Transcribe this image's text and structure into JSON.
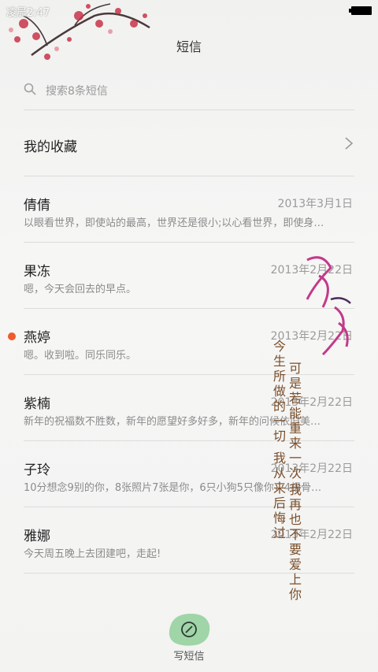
{
  "status": {
    "time": "凌晨2:47"
  },
  "header": {
    "title": "短信"
  },
  "search": {
    "placeholder": "搜索8条短信"
  },
  "favorites": {
    "label": "我的收藏"
  },
  "messages": [
    {
      "name": "倩倩",
      "date": "2013年3月1日",
      "preview": "以眼看世界，即使站的最高，世界还是很小;以心看世界，即使身…",
      "unread": false
    },
    {
      "name": "果冻",
      "date": "2013年2月22日",
      "preview": "嗯，今天会回去的早点。",
      "unread": false
    },
    {
      "name": "燕婷",
      "date": "2013年2月22日",
      "preview": "嗯。收到啦。同乐同乐。",
      "unread": true
    },
    {
      "name": "紫楠",
      "date": "2013年2月22日",
      "preview": "新年的祝福数不胜数，新年的愿望好多好多，新年的问候依旧美…",
      "unread": false
    },
    {
      "name": "子玲",
      "date": "2013年2月22日",
      "preview": "10分想念9别的你，8张照片7张是你，6只小狗5只像你，4根骨…",
      "unread": false
    },
    {
      "name": "雅娜",
      "date": "2013年2月22日",
      "preview": "今天周五晚上去团建吧，走起!",
      "unread": false
    }
  ],
  "poem": {
    "col1": "今生所做的一切",
    "col2": "可是若能重来一次",
    "col3": "我从来后悔过",
    "col4": "我再也不要爱上你"
  },
  "compose": {
    "label": "写短信"
  },
  "colors": {
    "unread": "#ee5b2c",
    "blossom": "#c8344a",
    "compose": "#8fcf9a"
  }
}
